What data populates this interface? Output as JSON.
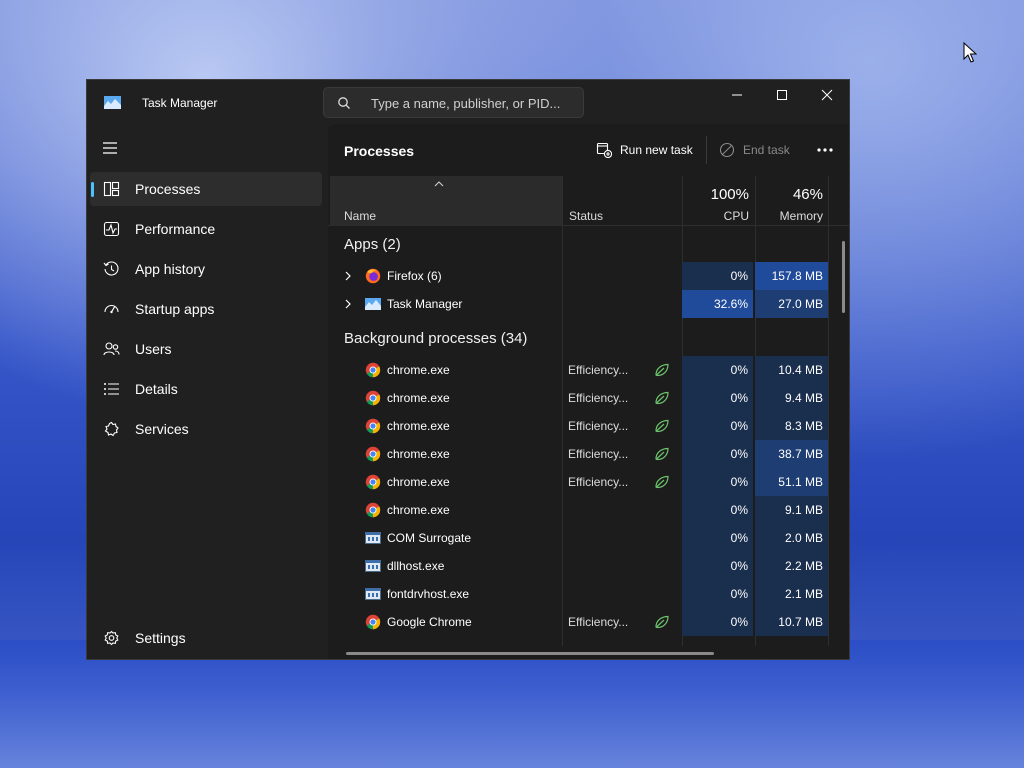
{
  "window": {
    "title": "Task Manager"
  },
  "search": {
    "placeholder": "Type a name, publisher, or PID..."
  },
  "sidebar": {
    "items": [
      {
        "label": "Processes",
        "icon": "processes-icon",
        "active": true
      },
      {
        "label": "Performance",
        "icon": "performance-icon"
      },
      {
        "label": "App history",
        "icon": "app-history-icon"
      },
      {
        "label": "Startup apps",
        "icon": "startup-apps-icon"
      },
      {
        "label": "Users",
        "icon": "users-icon"
      },
      {
        "label": "Details",
        "icon": "details-icon"
      },
      {
        "label": "Services",
        "icon": "services-icon"
      }
    ],
    "settings_label": "Settings"
  },
  "toolbar": {
    "title": "Processes",
    "run_new_task": "Run new task",
    "end_task": "End task"
  },
  "table": {
    "headers": {
      "name": "Name",
      "status": "Status",
      "cpu_pct": "100%",
      "cpu": "CPU",
      "mem_pct": "46%",
      "mem": "Memory"
    },
    "groups": {
      "apps": "Apps (2)",
      "background": "Background processes (34)"
    },
    "apps": [
      {
        "name": "Firefox (6)",
        "icon": "firefox-icon",
        "status": "",
        "cpu": "0%",
        "mem": "157.8 MB"
      },
      {
        "name": "Task Manager",
        "icon": "task-manager-icon",
        "status": "",
        "cpu": "32.6%",
        "mem": "27.0 MB"
      }
    ],
    "background": [
      {
        "name": "chrome.exe",
        "icon": "chrome-icon",
        "status": "Efficiency...",
        "eco": true,
        "cpu": "0%",
        "mem": "10.4 MB"
      },
      {
        "name": "chrome.exe",
        "icon": "chrome-icon",
        "status": "Efficiency...",
        "eco": true,
        "cpu": "0%",
        "mem": "9.4 MB"
      },
      {
        "name": "chrome.exe",
        "icon": "chrome-icon",
        "status": "Efficiency...",
        "eco": true,
        "cpu": "0%",
        "mem": "8.3 MB"
      },
      {
        "name": "chrome.exe",
        "icon": "chrome-icon",
        "status": "Efficiency...",
        "eco": true,
        "cpu": "0%",
        "mem": "38.7 MB"
      },
      {
        "name": "chrome.exe",
        "icon": "chrome-icon",
        "status": "Efficiency...",
        "eco": true,
        "cpu": "0%",
        "mem": "51.1 MB"
      },
      {
        "name": "chrome.exe",
        "icon": "chrome-icon",
        "status": "",
        "eco": false,
        "cpu": "0%",
        "mem": "9.1 MB"
      },
      {
        "name": "COM Surrogate",
        "icon": "system-process-icon",
        "status": "",
        "eco": false,
        "cpu": "0%",
        "mem": "2.0 MB"
      },
      {
        "name": "dllhost.exe",
        "icon": "system-process-icon",
        "status": "",
        "eco": false,
        "cpu": "0%",
        "mem": "2.2 MB"
      },
      {
        "name": "fontdrvhost.exe",
        "icon": "system-process-icon",
        "status": "",
        "eco": false,
        "cpu": "0%",
        "mem": "2.1 MB"
      },
      {
        "name": "Google Chrome",
        "icon": "chrome-icon",
        "status": "Efficiency...",
        "eco": true,
        "cpu": "0%",
        "mem": "10.7 MB"
      }
    ]
  },
  "colors": {
    "accent": "#4cc2ff",
    "heat_low": "#1a2e4e",
    "heat_mid": "#1e3d72",
    "heat_high": "#204a9a",
    "eco_green": "#6cc36c"
  }
}
